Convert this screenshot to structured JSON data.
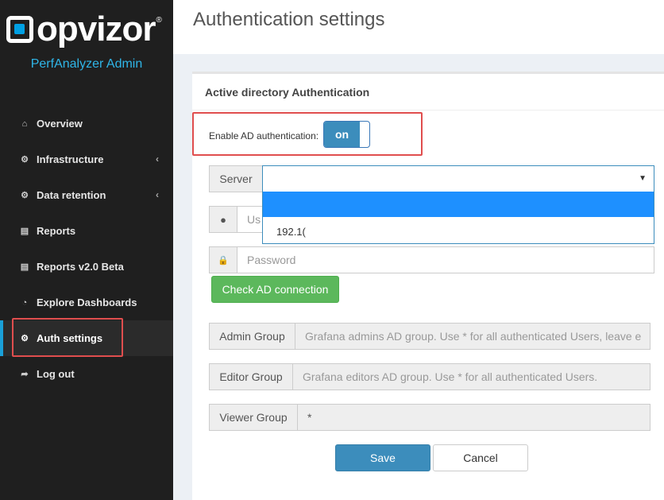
{
  "brand": {
    "logo_text": "opvizor",
    "registered": "®",
    "subtitle": "PerfAnalyzer Admin"
  },
  "sidebar": {
    "items": [
      {
        "label": "Overview",
        "icon": "home-icon",
        "glyph": "⌂"
      },
      {
        "label": "Infrastructure",
        "icon": "cogs-icon",
        "glyph": "⚙",
        "chevron": "‹"
      },
      {
        "label": "Data retention",
        "icon": "cogs-icon",
        "glyph": "⚙",
        "chevron": "‹"
      },
      {
        "label": "Reports",
        "icon": "report-icon",
        "glyph": "▤"
      },
      {
        "label": "Reports v2.0 Beta",
        "icon": "report-icon",
        "glyph": "▤"
      },
      {
        "label": "Explore Dashboards",
        "icon": "dashboard-icon",
        "glyph": "◔"
      },
      {
        "label": "Auth settings",
        "icon": "gear-icon",
        "glyph": "⚙",
        "active": true
      },
      {
        "label": "Log out",
        "icon": "logout-icon",
        "glyph": "➦"
      }
    ]
  },
  "header": {
    "title": "Authentication settings"
  },
  "panel": {
    "title": "Active directory Authentication",
    "enable_label": "Enable AD authentication:",
    "toggle_state": "on",
    "server": {
      "label": "Server",
      "value": "",
      "options": [
        "",
        "192.1("
      ]
    },
    "user": {
      "placeholder": "Us"
    },
    "password": {
      "placeholder": "Password"
    },
    "check_button": "Check AD connection",
    "admin_group": {
      "label": "Admin Group",
      "placeholder": "Grafana admins AD group. Use * for all authenticated Users, leave e"
    },
    "editor_group": {
      "label": "Editor Group",
      "placeholder": "Grafana editors AD group. Use * for all authenticated Users."
    },
    "viewer_group": {
      "label": "Viewer Group",
      "value": "*"
    },
    "save_button": "Save",
    "cancel_button": "Cancel"
  },
  "colors": {
    "accent": "#3c8dbc",
    "success": "#5cb85c",
    "highlight_box": "#e04e4e",
    "brand_cyan": "#2fb6e8"
  }
}
